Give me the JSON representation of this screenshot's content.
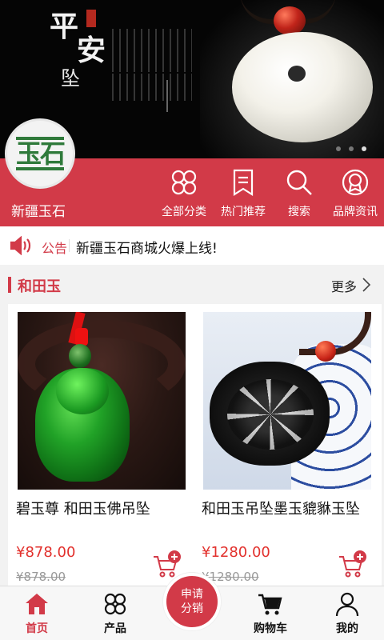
{
  "banner": {
    "title_line1": "平",
    "title_line2": "安",
    "title_line3": "坠",
    "slide_count": 3,
    "active_slide": 2
  },
  "brand": {
    "logo_text": "玉石",
    "name": "新疆玉石",
    "color": "#d23a48"
  },
  "nav": {
    "items": [
      {
        "label": "全部分类",
        "icon": "grid-icon"
      },
      {
        "label": "热门推荐",
        "icon": "bookmark-icon"
      },
      {
        "label": "搜索",
        "icon": "search-icon"
      },
      {
        "label": "品牌资讯",
        "icon": "award-icon"
      }
    ]
  },
  "notice": {
    "tag": "公告",
    "message": "新疆玉石商城火爆上线!"
  },
  "section": {
    "title": "和田玉",
    "more": "更多"
  },
  "products": [
    {
      "name": "碧玉尊 和田玉佛吊坠",
      "price": "¥878.00",
      "original_price": "¥878.00"
    },
    {
      "name": "和田玉吊坠墨玉貔貅玉坠",
      "price": "¥1280.00",
      "original_price": "¥1280.00"
    }
  ],
  "fab": {
    "line1": "申请",
    "line2": "分销"
  },
  "tabbar": {
    "items": [
      {
        "label": "首页",
        "icon": "home-icon",
        "active": true
      },
      {
        "label": "产品",
        "icon": "grid-icon",
        "active": false
      },
      {
        "label": "购物车",
        "icon": "cart-icon",
        "active": false
      },
      {
        "label": "我的",
        "icon": "user-icon",
        "active": false
      }
    ]
  }
}
